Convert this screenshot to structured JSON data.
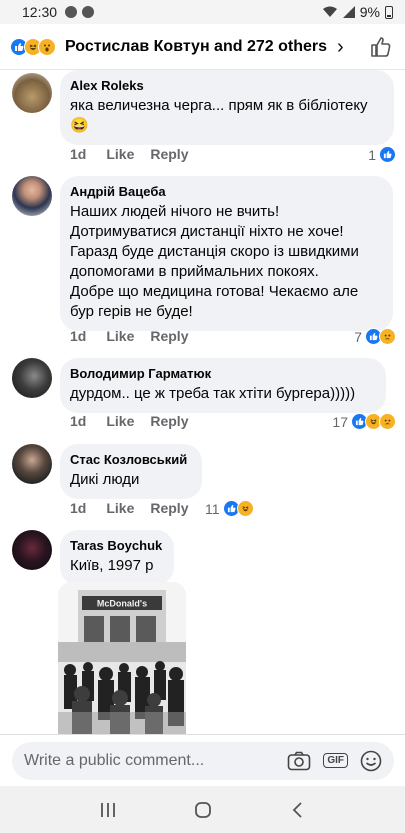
{
  "status_bar": {
    "time": "12:30",
    "battery": "9%"
  },
  "header": {
    "title": "Ростислав Ковтун and 272 others",
    "reaction_icons": [
      "like-icon",
      "haha-icon",
      "wow-icon"
    ]
  },
  "comments": [
    {
      "author": "Alex Roleks",
      "text": "яка величезна черга... прям як в бібліотеку😆",
      "time": "1d",
      "like_label": "Like",
      "reply_label": "Reply",
      "reaction_count": "1",
      "reactions": [
        "like-icon"
      ]
    },
    {
      "author": "Андрій Вацеба",
      "text": "Наших людей нічого не вчить!\nДотримуватися дистанції ніхто не хоче!\nГаразд буде дистанція скоро із швидкими допомогами в приймальних покоях.\nДобре що медицина готова! Чекаємо але бур герів не буде!",
      "time": "1d",
      "like_label": "Like",
      "reply_label": "Reply",
      "reaction_count": "7",
      "reactions": [
        "like-icon",
        "sad-icon"
      ]
    },
    {
      "author": "Володимир Гарматюк",
      "text": "дурдом.. це ж треба так хтіти бургера)))))",
      "time": "1d",
      "like_label": "Like",
      "reply_label": "Reply",
      "reaction_count": "17",
      "reactions": [
        "like-icon",
        "haha-icon",
        "sad-icon"
      ]
    },
    {
      "author": "Стас Козловський",
      "text": "Дикі люди",
      "time": "1d",
      "like_label": "Like",
      "reply_label": "Reply",
      "reaction_count": "11",
      "reactions": [
        "like-icon",
        "haha-icon"
      ]
    },
    {
      "author": "Taras Boychuk",
      "text": "Київ, 1997 р",
      "photo_sign": "McDonald's"
    }
  ],
  "composer": {
    "placeholder": "Write a public comment...",
    "gif_label": "GIF"
  },
  "colors": {
    "accent": "#1877f2",
    "bubble": "#f0f2f5",
    "secondary_text": "#65676b",
    "reaction_yellow": "#f7b125"
  }
}
